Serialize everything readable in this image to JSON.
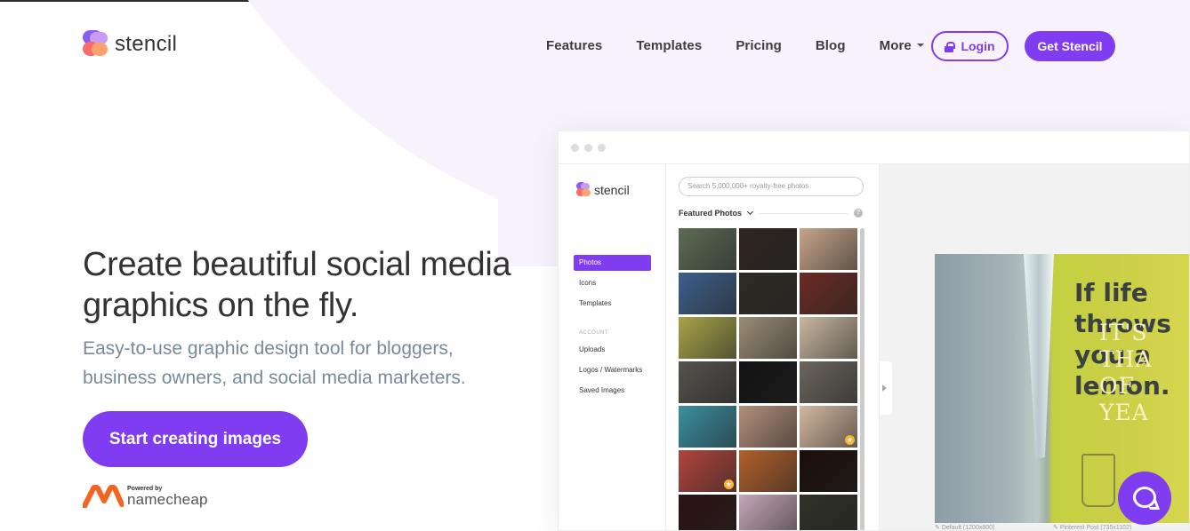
{
  "brand": {
    "name": "stencil",
    "accent": "#7f3cf0"
  },
  "nav": {
    "items": [
      "Features",
      "Templates",
      "Pricing",
      "Blog"
    ],
    "more": "More",
    "login": "Login",
    "get": "Get Stencil"
  },
  "hero": {
    "headline": "Create beautiful social media graphics on the fly.",
    "subheadline": "Easy-to-use graphic design tool for bloggers, business owners, and social media marketers.",
    "cta": "Start creating images"
  },
  "powered": {
    "label": "Powered by",
    "brand": "namecheap"
  },
  "mock": {
    "brand": "stencil",
    "sidebar": {
      "items": [
        "Photos",
        "Icons",
        "Templates"
      ],
      "section": "ACCOUNT",
      "account_items": [
        "Uploads",
        "Logos / Watermarks",
        "Saved Images"
      ]
    },
    "search_placeholder": "Search 5,000,000+ royalty-free photos",
    "featured": "Featured Photos",
    "help": "?",
    "quote_lines": [
      "If life",
      "throws",
      "you a",
      "lemon."
    ],
    "overlay_lines": [
      "IT'S THA",
      "OF YEA"
    ],
    "caption_left": "Default (1200x800)",
    "caption_right": "Pinterest Post (735x1102)"
  },
  "photos": [
    "#5d6c55",
    "#2e2520",
    "#c7a589",
    "#3d5f8a",
    "#2f2b24",
    "#6b2b23",
    "#a7a34a",
    "#9b8d76",
    "#c8b79f",
    "#55514c",
    "#121212",
    "#6c655e",
    "#3a8fa0",
    "#b38f7a",
    "#d4b8a0",
    "#b2443c",
    "#b2602c",
    "#1b0e08",
    "#2c1213",
    "#c6a7b8",
    "#2f3126"
  ]
}
